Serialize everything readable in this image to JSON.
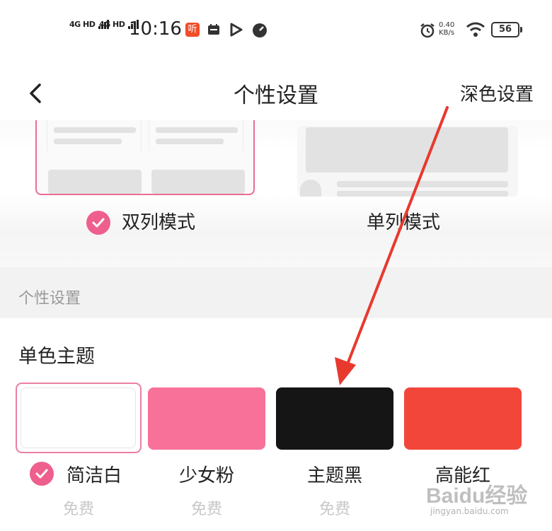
{
  "status_bar": {
    "signal1": "4G HD",
    "signal2": "4G HD",
    "time": "10:16",
    "app_badge": "听",
    "net_speed_value": "0.40",
    "net_speed_unit": "KB/s",
    "battery": "56"
  },
  "header": {
    "back_icon": "chevron-left-icon",
    "title": "个性设置",
    "right_action": "深色设置"
  },
  "layout_modes": [
    {
      "label": "双列模式",
      "selected": true
    },
    {
      "label": "单列模式",
      "selected": false
    }
  ],
  "section": {
    "title": "个性设置"
  },
  "mono_theme": {
    "title": "单色主题",
    "themes": [
      {
        "name": "简洁白",
        "price": "免费",
        "color": "#ffffff",
        "selected": true
      },
      {
        "name": "少女粉",
        "price": "免费",
        "color": "#f87198",
        "selected": false
      },
      {
        "name": "主题黑",
        "price": "免费",
        "color": "#151515",
        "selected": false
      },
      {
        "name": "高能红",
        "price": "",
        "color": "#f2463a",
        "selected": false
      }
    ]
  },
  "accent_color": "#ee5f8d",
  "annotation_color": "#e8392f",
  "watermark": {
    "logo": "Baidu经验",
    "sub": "jingyan.baidu.com"
  }
}
